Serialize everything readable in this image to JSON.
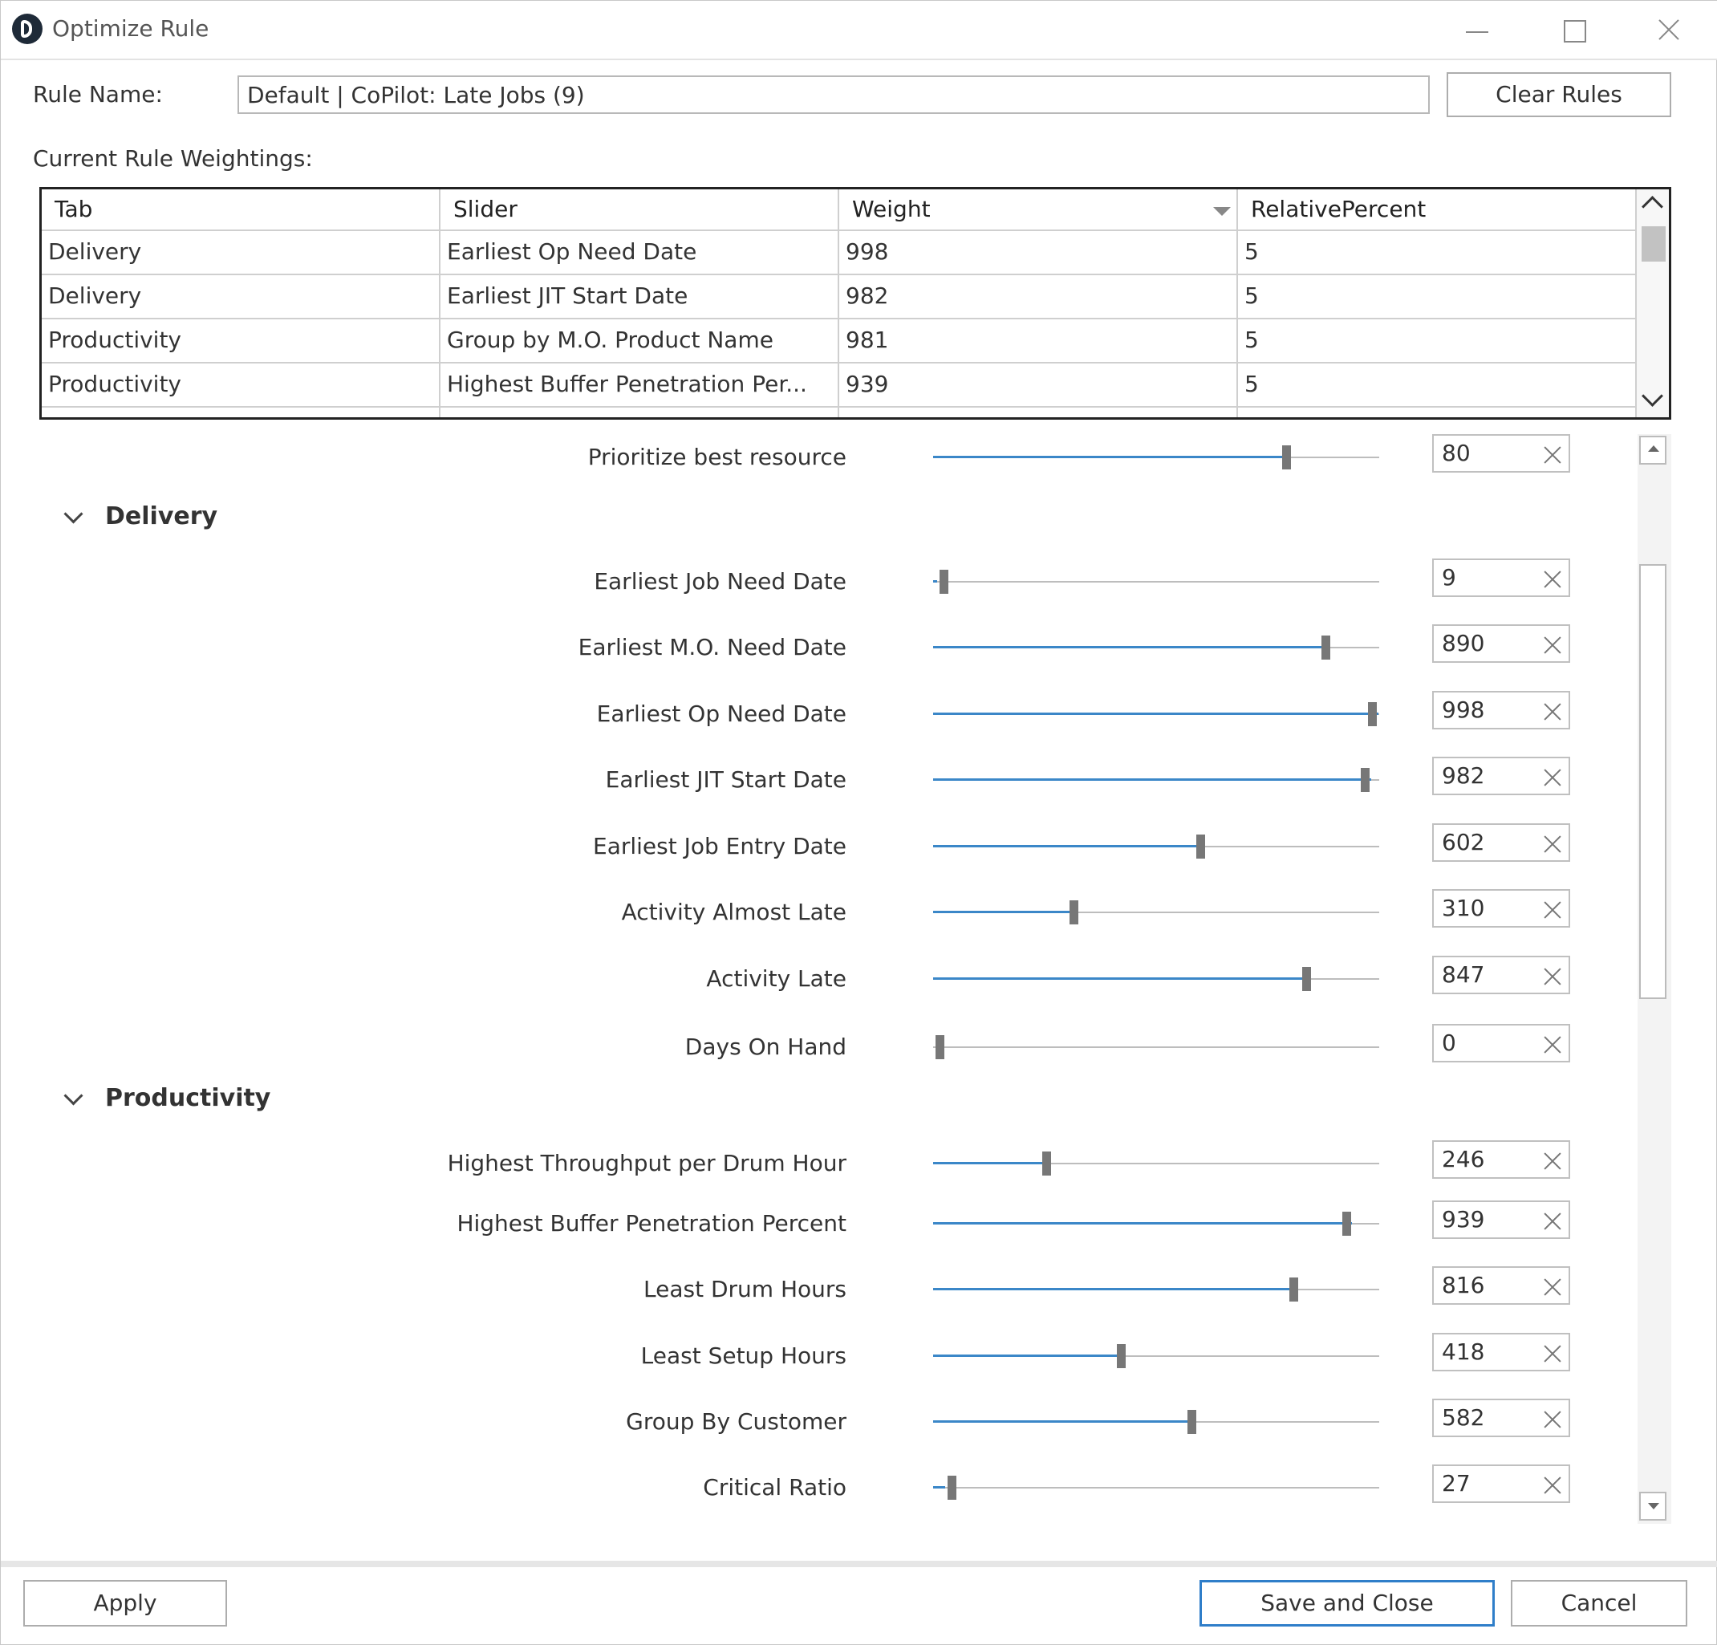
{
  "window": {
    "title": "Optimize Rule"
  },
  "rule_name": {
    "label": "Rule Name:",
    "value": "Default | CoPilot: Late Jobs (9)"
  },
  "buttons": {
    "clear_rules": "Clear Rules",
    "apply": "Apply",
    "save_close": "Save and Close",
    "cancel": "Cancel"
  },
  "weightings": {
    "label": "Current Rule Weightings:",
    "columns": [
      "Tab",
      "Slider",
      "Weight",
      "RelativePercent"
    ],
    "rows": [
      [
        "Delivery",
        "Earliest Op Need Date",
        "998",
        "5"
      ],
      [
        "Delivery",
        "Earliest JIT Start Date",
        "982",
        "5"
      ],
      [
        "Productivity",
        "Group by M.O. Product Name",
        "981",
        "5"
      ],
      [
        "Productivity",
        "Highest Buffer Penetration Per...",
        "939",
        "5"
      ]
    ]
  },
  "slider_max": 1000,
  "top_slider": {
    "label": "Prioritize best resource",
    "value": "80",
    "level": 800
  },
  "sections": [
    {
      "title": "Delivery",
      "sliders": [
        {
          "label": "Earliest Job Need Date",
          "value": "9"
        },
        {
          "label": "Earliest M.O. Need Date",
          "value": "890"
        },
        {
          "label": "Earliest Op Need Date",
          "value": "998"
        },
        {
          "label": "Earliest JIT Start Date",
          "value": "982"
        },
        {
          "label": "Earliest Job Entry Date",
          "value": "602"
        },
        {
          "label": "Activity Almost Late",
          "value": "310"
        },
        {
          "label": "Activity Late",
          "value": "847"
        },
        {
          "label": "Days On Hand",
          "value": "0"
        }
      ]
    },
    {
      "title": "Productivity",
      "sliders": [
        {
          "label": "Highest Throughput per Drum Hour",
          "value": "246"
        },
        {
          "label": "Highest Buffer Penetration Percent",
          "value": "939"
        },
        {
          "label": "Least Drum Hours",
          "value": "816"
        },
        {
          "label": "Least Setup Hours",
          "value": "418"
        },
        {
          "label": "Group By Customer",
          "value": "582"
        },
        {
          "label": "Critical Ratio",
          "value": "27"
        }
      ]
    }
  ]
}
